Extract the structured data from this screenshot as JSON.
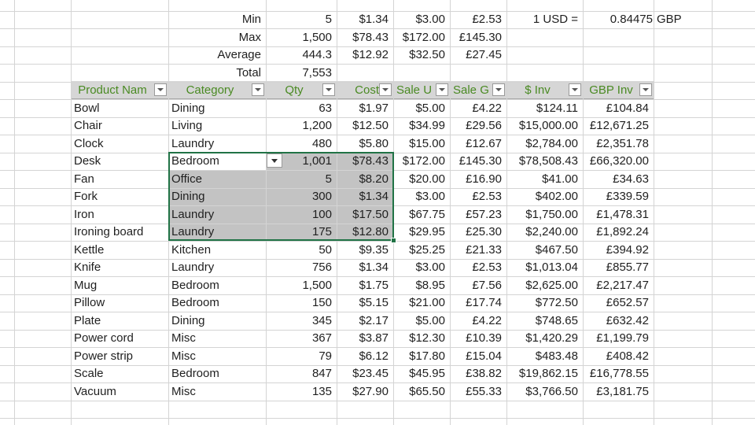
{
  "summary": [
    {
      "label": "Min",
      "qty": "5",
      "cost": "$1.34",
      "sale_usd": "$3.00",
      "sale_gbp": "£2.53"
    },
    {
      "label": "Max",
      "qty": "1,500",
      "cost": "$78.43",
      "sale_usd": "$172.00",
      "sale_gbp": "£145.30"
    },
    {
      "label": "Average",
      "qty": "444.3",
      "cost": "$12.92",
      "sale_usd": "$32.50",
      "sale_gbp": "£27.45"
    },
    {
      "label": "Total",
      "qty": "7,553"
    }
  ],
  "exchange": {
    "label": "1 USD =",
    "rate": "0.84475",
    "currency": "GBP"
  },
  "headers": [
    "Product Nam",
    "Category",
    "Qty",
    "Cost",
    "Sale U",
    "Sale G",
    "$ Inv",
    "GBP Inv"
  ],
  "rows": [
    [
      "Bowl",
      "Dining",
      "63",
      "$1.97",
      "$5.00",
      "£4.22",
      "$124.11",
      "£104.84"
    ],
    [
      "Chair",
      "Living",
      "1,200",
      "$12.50",
      "$34.99",
      "£29.56",
      "$15,000.00",
      "£12,671.25"
    ],
    [
      "Clock",
      "Laundry",
      "480",
      "$5.80",
      "$15.00",
      "£12.67",
      "$2,784.00",
      "£2,351.78"
    ],
    [
      "Desk",
      "Bedroom",
      "1,001",
      "$78.43",
      "$172.00",
      "£145.30",
      "$78,508.43",
      "£66,320.00"
    ],
    [
      "Fan",
      "Office",
      "5",
      "$8.20",
      "$20.00",
      "£16.90",
      "$41.00",
      "£34.63"
    ],
    [
      "Fork",
      "Dining",
      "300",
      "$1.34",
      "$3.00",
      "£2.53",
      "$402.00",
      "£339.59"
    ],
    [
      "Iron",
      "Laundry",
      "100",
      "$17.50",
      "$67.75",
      "£57.23",
      "$1,750.00",
      "£1,478.31"
    ],
    [
      "Ironing board",
      "Laundry",
      "175",
      "$12.80",
      "$29.95",
      "£25.30",
      "$2,240.00",
      "£1,892.24"
    ],
    [
      "Kettle",
      "Kitchen",
      "50",
      "$9.35",
      "$25.25",
      "£21.33",
      "$467.50",
      "£394.92"
    ],
    [
      "Knife",
      "Laundry",
      "756",
      "$1.34",
      "$3.00",
      "£2.53",
      "$1,013.04",
      "£855.77"
    ],
    [
      "Mug",
      "Bedroom",
      "1,500",
      "$1.75",
      "$8.95",
      "£7.56",
      "$2,625.00",
      "£2,217.47"
    ],
    [
      "Pillow",
      "Bedroom",
      "150",
      "$5.15",
      "$21.00",
      "£17.74",
      "$772.50",
      "£652.57"
    ],
    [
      "Plate",
      "Dining",
      "345",
      "$2.17",
      "$5.00",
      "£4.22",
      "$748.65",
      "£632.42"
    ],
    [
      "Power cord",
      "Misc",
      "367",
      "$3.87",
      "$12.30",
      "£10.39",
      "$1,420.29",
      "£1,199.79"
    ],
    [
      "Power strip",
      "Misc",
      "79",
      "$6.12",
      "$17.80",
      "£15.04",
      "$483.48",
      "£408.42"
    ],
    [
      "Scale",
      "Bedroom",
      "847",
      "$23.45",
      "$45.95",
      "£38.82",
      "$19,862.15",
      "£16,778.55"
    ],
    [
      "Vacuum",
      "Misc",
      "135",
      "$27.90",
      "$65.50",
      "£55.33",
      "$3,766.50",
      "£3,181.75"
    ]
  ],
  "colors": {
    "header_text": "#4a8a23",
    "selection_border": "#217346",
    "selection_fill": "#c3c3c3",
    "grid": "#d4d4d4"
  }
}
